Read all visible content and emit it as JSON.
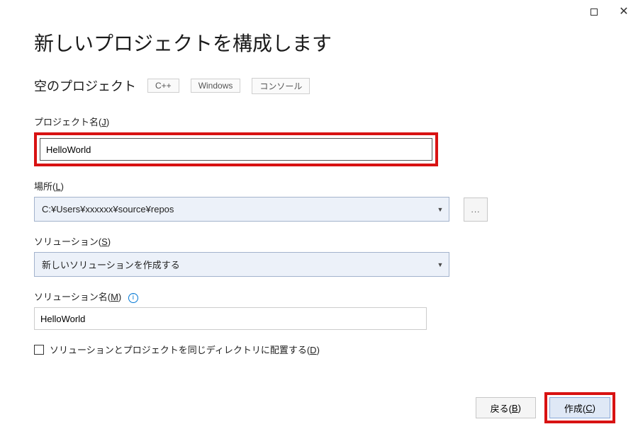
{
  "window": {
    "title": "新しいプロジェクトを構成します"
  },
  "template": {
    "name": "空のプロジェクト",
    "tags": [
      "C++",
      "Windows",
      "コンソール"
    ]
  },
  "fields": {
    "projectName": {
      "label_pre": "プロジェクト名(",
      "label_key": "J",
      "label_post": ")",
      "value": "HelloWorld"
    },
    "location": {
      "label_pre": "場所(",
      "label_key": "L",
      "label_post": ")",
      "value": "C:¥Users¥xxxxxx¥source¥repos",
      "browse": "..."
    },
    "solution": {
      "label_pre": "ソリューション(",
      "label_key": "S",
      "label_post": ")",
      "value": "新しいソリューションを作成する"
    },
    "solutionName": {
      "label_pre": "ソリューション名(",
      "label_key": "M",
      "label_post": ")",
      "value": "HelloWorld"
    },
    "sameDir": {
      "label_pre": "ソリューションとプロジェクトを同じディレクトリに配置する(",
      "label_key": "D",
      "label_post": ")"
    }
  },
  "footer": {
    "back_pre": "戻る(",
    "back_key": "B",
    "back_post": ")",
    "create_pre": "作成(",
    "create_key": "C",
    "create_post": ")"
  }
}
